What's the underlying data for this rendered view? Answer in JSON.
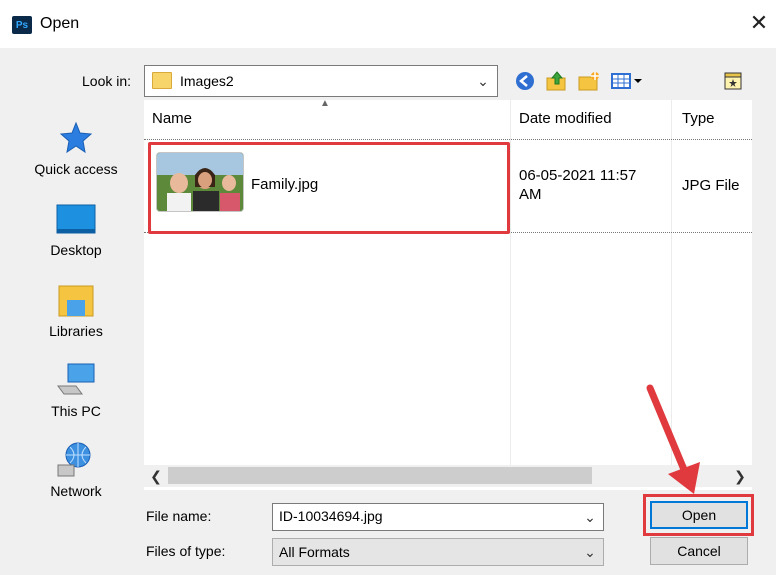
{
  "window": {
    "app_icon_text": "Ps",
    "title": "Open",
    "close_glyph": "✕"
  },
  "toolbar": {
    "look_in_label": "Look in:",
    "look_in_value": "Images2",
    "icons": [
      "back-icon",
      "up-folder-icon",
      "new-folder-icon",
      "view-menu-icon",
      "properties-icon"
    ]
  },
  "places": [
    {
      "label": "Quick access",
      "icon": "star-icon"
    },
    {
      "label": "Desktop",
      "icon": "desktop-icon"
    },
    {
      "label": "Libraries",
      "icon": "libraries-icon"
    },
    {
      "label": "This PC",
      "icon": "computer-icon"
    },
    {
      "label": "Network",
      "icon": "network-icon"
    }
  ],
  "columns": {
    "name": "Name",
    "date": "Date modified",
    "type": "Type"
  },
  "files": [
    {
      "name": "Family.jpg",
      "date_line1": "06-05-2021 11:57",
      "date_line2": "AM",
      "type": "JPG File"
    }
  ],
  "form": {
    "file_name_label": "File name:",
    "file_name_value": "ID-10034694.jpg",
    "file_type_label": "Files of type:",
    "file_type_value": "All Formats",
    "open_label": "Open",
    "cancel_label": "Cancel"
  },
  "colors": {
    "highlight": "#e0393e",
    "focus_border": "#0078d7"
  }
}
